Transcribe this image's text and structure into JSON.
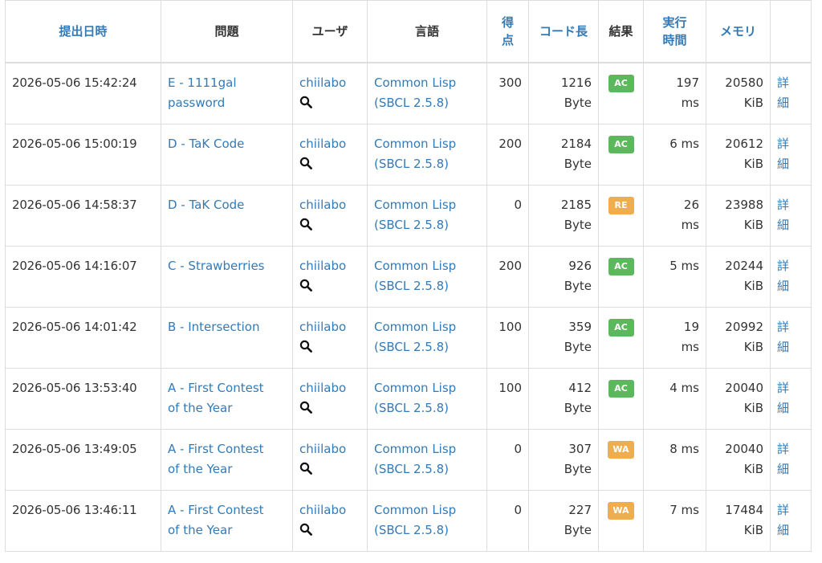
{
  "header": {
    "submitted_at": "提出日時",
    "problem": "問題",
    "user": "ユーザ",
    "language": "言語",
    "score_l1": "得",
    "score_l2": "点",
    "code_length": "コード長",
    "result": "結果",
    "exec_l1": "実行",
    "exec_l2": "時間",
    "memory": "メモリ"
  },
  "colors": {
    "link": "#337ab7",
    "ac": "#5cb85c",
    "warn": "#f0ad4e",
    "border": "#dddddd"
  },
  "icons": {
    "user_search": "search-icon"
  },
  "rows": [
    {
      "date": "2026-05-06 15:42:24",
      "problem_l1": "E - 1111gal",
      "problem_l2": "password",
      "user": "chiilabo",
      "lang_l1": "Common Lisp",
      "lang_l2": "(SBCL 2.5.8)",
      "score": "300",
      "len_l1": "1216",
      "len_l2": "Byte",
      "result": "AC",
      "time_l1": "197",
      "time_l2": "ms",
      "mem_l1": "20580",
      "mem_l2": "KiB",
      "detail_l1": "詳",
      "detail_l2": "細"
    },
    {
      "date": "2026-05-06 15:00:19",
      "problem_l1": "D - TaK Code",
      "problem_l2": "",
      "user": "chiilabo",
      "lang_l1": "Common Lisp",
      "lang_l2": "(SBCL 2.5.8)",
      "score": "200",
      "len_l1": "2184",
      "len_l2": "Byte",
      "result": "AC",
      "time_l1": "6 ms",
      "time_l2": "",
      "mem_l1": "20612",
      "mem_l2": "KiB",
      "detail_l1": "詳",
      "detail_l2": "細"
    },
    {
      "date": "2026-05-06 14:58:37",
      "problem_l1": "D - TaK Code",
      "problem_l2": "",
      "user": "chiilabo",
      "lang_l1": "Common Lisp",
      "lang_l2": "(SBCL 2.5.8)",
      "score": "0",
      "len_l1": "2185",
      "len_l2": "Byte",
      "result": "RE",
      "time_l1": "26",
      "time_l2": "ms",
      "mem_l1": "23988",
      "mem_l2": "KiB",
      "detail_l1": "詳",
      "detail_l2": "細"
    },
    {
      "date": "2026-05-06 14:16:07",
      "problem_l1": "C - Strawberries",
      "problem_l2": "",
      "user": "chiilabo",
      "lang_l1": "Common Lisp",
      "lang_l2": "(SBCL 2.5.8)",
      "score": "200",
      "len_l1": "926",
      "len_l2": "Byte",
      "result": "AC",
      "time_l1": "5 ms",
      "time_l2": "",
      "mem_l1": "20244",
      "mem_l2": "KiB",
      "detail_l1": "詳",
      "detail_l2": "細"
    },
    {
      "date": "2026-05-06 14:01:42",
      "problem_l1": "B - Intersection",
      "problem_l2": "",
      "user": "chiilabo",
      "lang_l1": "Common Lisp",
      "lang_l2": "(SBCL 2.5.8)",
      "score": "100",
      "len_l1": "359",
      "len_l2": "Byte",
      "result": "AC",
      "time_l1": "19",
      "time_l2": "ms",
      "mem_l1": "20992",
      "mem_l2": "KiB",
      "detail_l1": "詳",
      "detail_l2": "細"
    },
    {
      "date": "2026-05-06 13:53:40",
      "problem_l1": "A - First Contest",
      "problem_l2": "of the Year",
      "user": "chiilabo",
      "lang_l1": "Common Lisp",
      "lang_l2": "(SBCL 2.5.8)",
      "score": "100",
      "len_l1": "412",
      "len_l2": "Byte",
      "result": "AC",
      "time_l1": "4 ms",
      "time_l2": "",
      "mem_l1": "20040",
      "mem_l2": "KiB",
      "detail_l1": "詳",
      "detail_l2": "細"
    },
    {
      "date": "2026-05-06 13:49:05",
      "problem_l1": "A - First Contest",
      "problem_l2": "of the Year",
      "user": "chiilabo",
      "lang_l1": "Common Lisp",
      "lang_l2": "(SBCL 2.5.8)",
      "score": "0",
      "len_l1": "307",
      "len_l2": "Byte",
      "result": "WA",
      "time_l1": "8 ms",
      "time_l2": "",
      "mem_l1": "20040",
      "mem_l2": "KiB",
      "detail_l1": "詳",
      "detail_l2": "細"
    },
    {
      "date": "2026-05-06 13:46:11",
      "problem_l1": "A - First Contest",
      "problem_l2": "of the Year",
      "user": "chiilabo",
      "lang_l1": "Common Lisp",
      "lang_l2": "(SBCL 2.5.8)",
      "score": "0",
      "len_l1": "227",
      "len_l2": "Byte",
      "result": "WA",
      "time_l1": "7 ms",
      "time_l2": "",
      "mem_l1": "17484",
      "mem_l2": "KiB",
      "detail_l1": "詳",
      "detail_l2": "細"
    }
  ]
}
